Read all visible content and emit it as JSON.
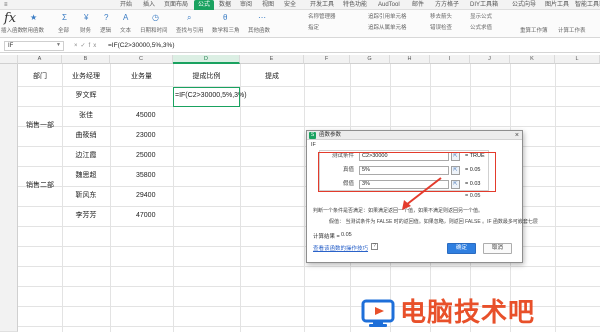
{
  "menu": {
    "tabs": [
      "开始",
      "插入",
      "页面布局",
      "公式",
      "数据",
      "审阅",
      "视图",
      "安全",
      "开发工具",
      "特色功能",
      "AudTool",
      "邮件",
      "方方格子",
      "DIY工具箱",
      "公式向导",
      "图片工具",
      "智能工具箱"
    ],
    "active_tab": "公式"
  },
  "ribbon": {
    "insert_function": "插入函数",
    "items": [
      "常用函数",
      "全部",
      "财务",
      "逻辑",
      "文本",
      "日期和时间",
      "查找与引用",
      "数学和三角",
      "其他函数"
    ],
    "right_items": [
      "名称管理器",
      "指定",
      "追踪引用单元格",
      "追踪从属单元格",
      "移去箭头",
      "显示公式",
      "错误检查",
      "公式求值",
      "重算工作簿",
      "计算工作表"
    ]
  },
  "formula_bar": {
    "name_box": "IF",
    "formula": "=IF(C2>30000,5%,3%)"
  },
  "columns": [
    "A",
    "B",
    "C",
    "D",
    "E",
    "F",
    "G",
    "H",
    "I",
    "J",
    "K",
    "L"
  ],
  "selected_column": "D",
  "table": {
    "headers": [
      "部门",
      "业务经理",
      "业务量",
      "提成比例",
      "提成"
    ],
    "rows": [
      {
        "dept": "",
        "manager": "罗文辉",
        "volume": "",
        "rate": "=IF(C2>30000,5%,3%)"
      },
      {
        "dept": "销售一部",
        "manager": "张佳",
        "volume": "45000",
        "rate": ""
      },
      {
        "dept": "",
        "manager": "曲筱绡",
        "volume": "23000",
        "rate": ""
      },
      {
        "dept": "",
        "manager": "边江霞",
        "volume": "25000",
        "rate": ""
      },
      {
        "dept": "",
        "manager": "魏思超",
        "volume": "35800",
        "rate": ""
      },
      {
        "dept": "销售二部",
        "manager": "靳风东",
        "volume": "29400",
        "rate": ""
      },
      {
        "dept": "",
        "manager": "李芳芳",
        "volume": "47000",
        "rate": ""
      }
    ]
  },
  "dialog": {
    "title": "函数参数",
    "function_name": "IF",
    "args": [
      {
        "label": "测试条件",
        "value": "C2>30000",
        "result": "= TRUE"
      },
      {
        "label": "真值",
        "value": "5%",
        "result": "= 0.05"
      },
      {
        "label": "假值",
        "value": "3%",
        "result": "= 0.03"
      }
    ],
    "formula_result": "= 0.05",
    "description": "判断一个条件是否满足：如果满足返回一个值，如果不满足则返回另一个值。",
    "param_description": "假值：  当测试条件为 FALSE 时的返回值。如果忽略，则返回 FALSE 。IF 函数最多可嵌套七层",
    "calc_label": "计算结果 =",
    "calc_value": "0.05",
    "help_link": "查看该函数的操作技巧",
    "ok_label": "确定",
    "cancel_label": "取消"
  },
  "watermark": {
    "text": "电脑技术吧",
    "logo_color": "#1e6fd9",
    "text_color": "#e8502a"
  },
  "colors": {
    "accent": "#1aa260",
    "highlight": "#e33b2c"
  }
}
